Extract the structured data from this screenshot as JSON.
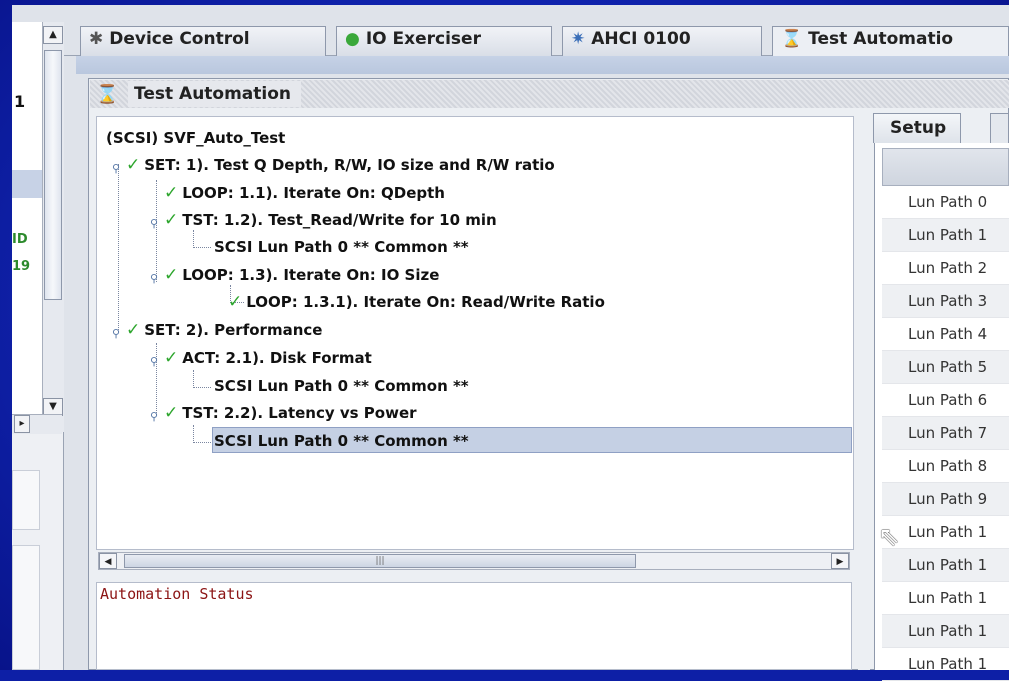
{
  "tabs": [
    {
      "label": "Device Control",
      "icon": "gear-icon"
    },
    {
      "label": "IO Exerciser",
      "icon": "green-circle-icon"
    },
    {
      "label": "AHCI  0100",
      "icon": "bug-icon"
    },
    {
      "label": "Test Automatio",
      "icon": "hourglass-icon"
    }
  ],
  "sidebar": {
    "text_1": "1",
    "text_id": "ID",
    "text_19": "19"
  },
  "panel": {
    "title": "Test Automation"
  },
  "tree": {
    "root": "(SCSI) SVF_Auto_Test",
    "nodes": [
      {
        "label": "SET: 1).  Test Q Depth, R/W, IO size and R/W ratio",
        "checked": true
      },
      {
        "label": "LOOP: 1.1).  Iterate On: QDepth",
        "checked": true
      },
      {
        "label": "TST: 1.2).  Test_Read/Write for 10 min",
        "checked": true
      },
      {
        "label": "SCSI Lun Path 0  ** Common **",
        "checked": false
      },
      {
        "label": "LOOP: 1.3).  Iterate On: IO Size",
        "checked": true
      },
      {
        "label": "LOOP: 1.3.1).  Iterate On: Read/Write Ratio",
        "checked": true
      },
      {
        "label": "SET: 2).  Performance",
        "checked": true
      },
      {
        "label": "ACT: 2.1).  Disk Format",
        "checked": true
      },
      {
        "label": "SCSI Lun Path 0  ** Common **",
        "checked": false
      },
      {
        "label": "TST: 2.2).  Latency vs Power",
        "checked": true
      },
      {
        "label": "SCSI Lun Path 0  ** Common **",
        "checked": false,
        "selected": true
      }
    ]
  },
  "status": {
    "label": "Automation Status"
  },
  "right_panel": {
    "tab_label": "Setup",
    "rows": [
      "Lun Path 0",
      "Lun Path 1",
      "Lun Path 2",
      "Lun Path 3",
      "Lun Path 4",
      "Lun Path 5",
      "Lun Path 6",
      "Lun Path 7",
      "Lun Path 8",
      "Lun Path 9",
      "Lun Path 1",
      "Lun Path 1",
      "Lun Path 1",
      "Lun Path 1",
      "Lun Path 1"
    ]
  }
}
